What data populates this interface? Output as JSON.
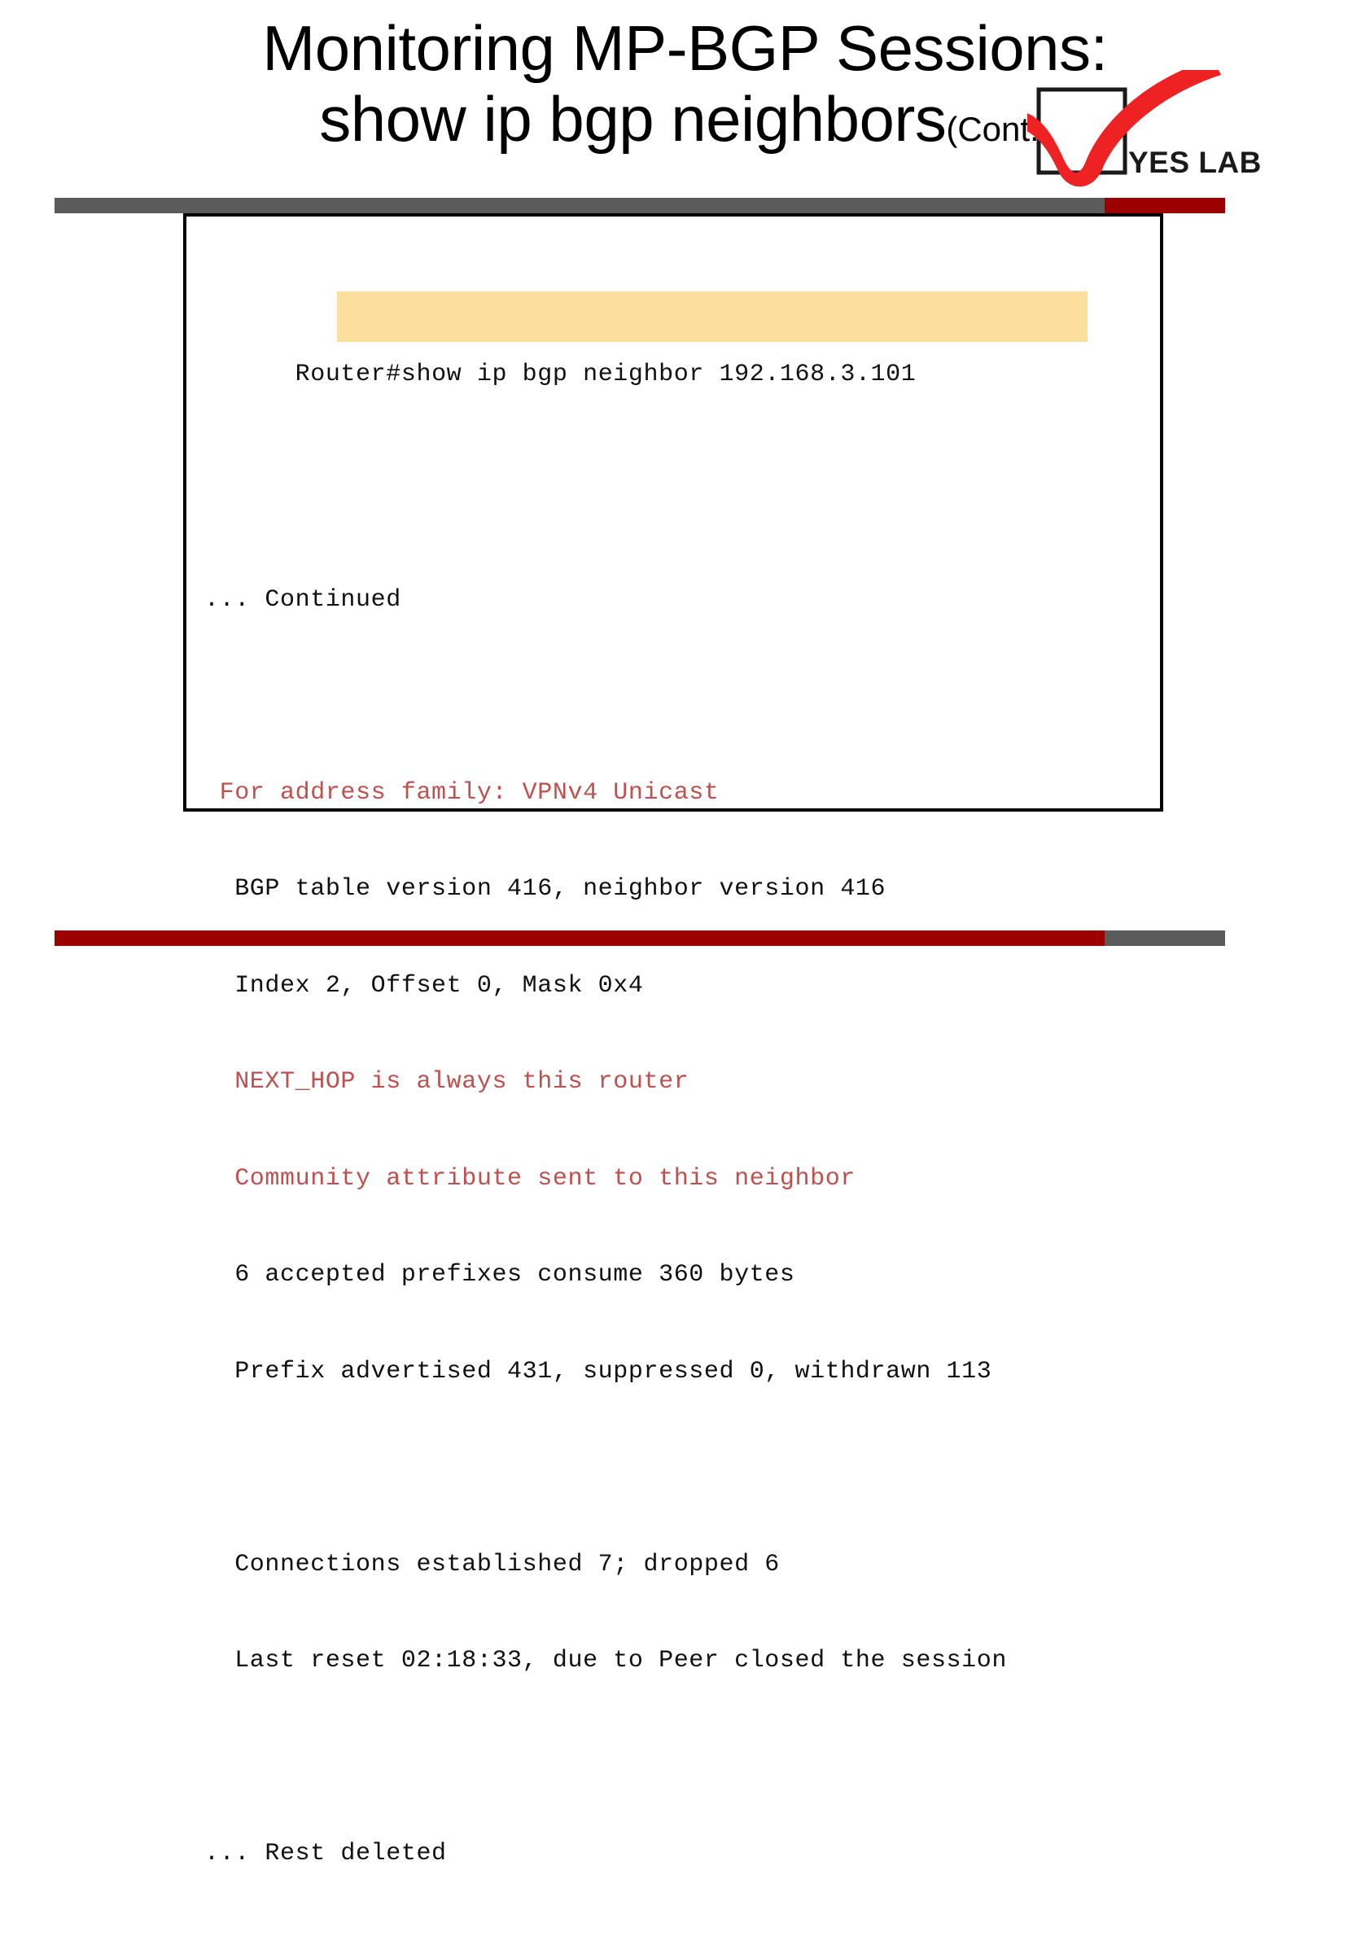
{
  "slide": {
    "title_line1": "Monitoring MP-BGP Sessions:",
    "title_line2": "show ip bgp neighbors",
    "title_suffix": "(Cont.)"
  },
  "logo": {
    "text": "YES LAB",
    "checkmark_color": "#EE2222",
    "box_color": "#1A1A1A"
  },
  "decor": {
    "bar_gray_color": "#5B5B5B",
    "bar_red_color": "#9C0000"
  },
  "terminal": {
    "highlight_color": "#FCDF9C",
    "red_text_color": "#C0504D",
    "prompt": "Router#",
    "command": "show ip bgp neighbor 192.168.3.101",
    "lines": [
      {
        "text": "... Continued",
        "color": "black"
      },
      {
        "text": "",
        "color": "black"
      },
      {
        "text": " For address family: VPNv4 Unicast",
        "color": "red"
      },
      {
        "text": "  BGP table version 416, neighbor version 416",
        "color": "black"
      },
      {
        "text": "  Index 2, Offset 0, Mask 0x4",
        "color": "black"
      },
      {
        "text": "  NEXT_HOP is always this router",
        "color": "red"
      },
      {
        "text": "  Community attribute sent to this neighbor",
        "color": "red"
      },
      {
        "text": "  6 accepted prefixes consume 360 bytes",
        "color": "black"
      },
      {
        "text": "  Prefix advertised 431, suppressed 0, withdrawn 113",
        "color": "black"
      },
      {
        "text": "",
        "color": "black"
      },
      {
        "text": "  Connections established 7; dropped 6",
        "color": "black"
      },
      {
        "text": "  Last reset 02:18:33, due to Peer closed the session",
        "color": "black"
      },
      {
        "text": "",
        "color": "black"
      },
      {
        "text": "... Rest deleted",
        "color": "black"
      }
    ]
  }
}
